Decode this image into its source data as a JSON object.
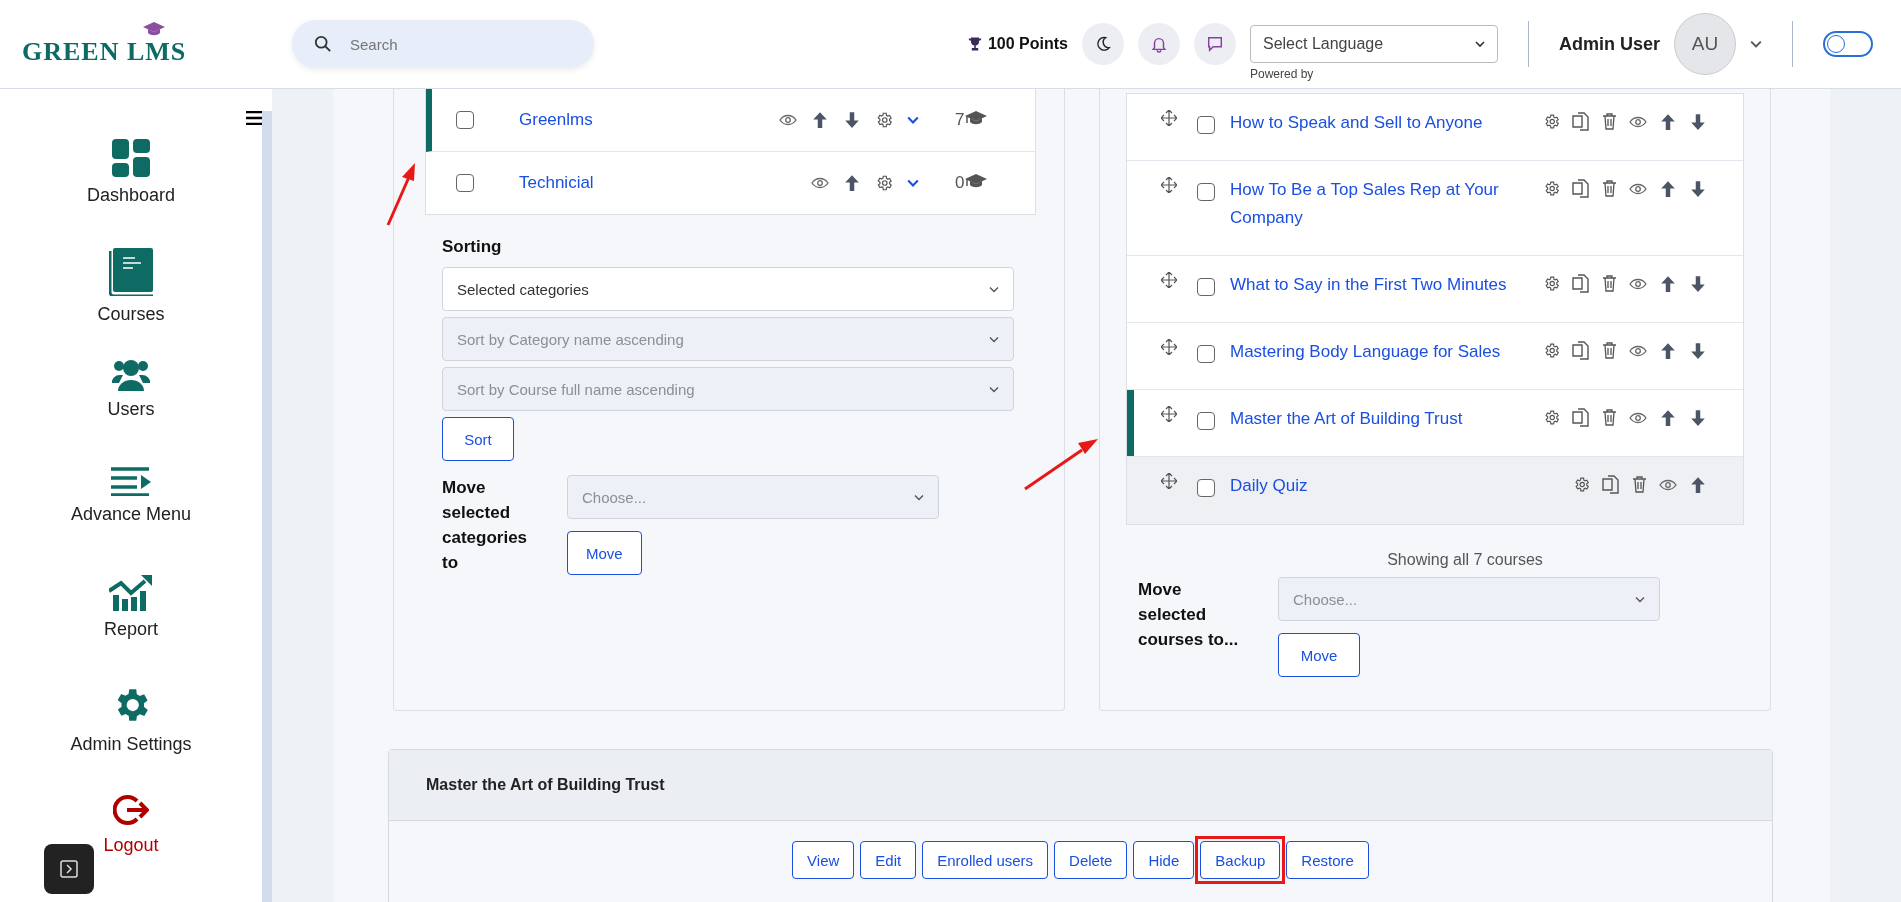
{
  "header": {
    "logo": "GREEN LMS",
    "search": {
      "placeholder": "Search"
    },
    "points": "100 Points",
    "language": {
      "value": "Select Language",
      "note": "Powered by"
    },
    "user": {
      "name": "Admin User",
      "initials": "AU"
    },
    "toggle": {
      "on": false
    }
  },
  "sidebar": {
    "items": [
      {
        "label": "Dashboard",
        "kind": "normal"
      },
      {
        "label": "Courses",
        "kind": "normal"
      },
      {
        "label": "Users",
        "kind": "normal"
      },
      {
        "label": "Advance Menu",
        "kind": "normal"
      },
      {
        "label": "Report",
        "kind": "normal"
      },
      {
        "label": "Admin Settings",
        "kind": "normal"
      },
      {
        "label": "Logout",
        "kind": "danger"
      }
    ]
  },
  "categories": {
    "rows": [
      {
        "name": "Greenlms",
        "count": "7",
        "checked": false,
        "highlighted": true,
        "can_move_down": true
      },
      {
        "name": "Technicial",
        "count": "0",
        "checked": false,
        "highlighted": false,
        "can_move_down": false
      }
    ],
    "sorting": {
      "label": "Sorting",
      "selects": [
        {
          "value": "Selected categories",
          "disabled": false
        },
        {
          "value": "Sort by Category name ascending",
          "disabled": true
        },
        {
          "value": "Sort by Course full name ascending",
          "disabled": true
        }
      ],
      "button": "Sort"
    },
    "move": {
      "label": "Move selected categories to",
      "placeholder": "Choose...",
      "disabled": true,
      "button": "Move"
    }
  },
  "courses": {
    "rows": [
      {
        "name": "How to Speak and Sell to Anyone",
        "checked": false,
        "highlighted": false,
        "hovered": false,
        "can_move_down": true
      },
      {
        "name": "How To Be a Top Sales Rep at Your Company",
        "checked": false,
        "highlighted": false,
        "hovered": false,
        "can_move_down": true
      },
      {
        "name": "What to Say in the First Two Minutes",
        "checked": false,
        "highlighted": false,
        "hovered": false,
        "can_move_down": true
      },
      {
        "name": "Mastering Body Language for Sales",
        "checked": false,
        "highlighted": false,
        "hovered": false,
        "can_move_down": true
      },
      {
        "name": "Master the Art of Building Trust",
        "checked": false,
        "highlighted": true,
        "hovered": false,
        "can_move_down": true
      },
      {
        "name": "Daily Quiz",
        "checked": false,
        "highlighted": false,
        "hovered": true,
        "can_move_down": false
      }
    ],
    "summary": "Showing all 7 courses",
    "move": {
      "label": "Move selected courses to...",
      "placeholder": "Choose...",
      "disabled": true,
      "button": "Move"
    }
  },
  "detail": {
    "title": "Master the Art of Building Trust",
    "buttons": [
      {
        "label": "View",
        "highlighted": false
      },
      {
        "label": "Edit",
        "highlighted": false
      },
      {
        "label": "Enrolled users",
        "highlighted": false
      },
      {
        "label": "Delete",
        "highlighted": false
      },
      {
        "label": "Hide",
        "highlighted": false
      },
      {
        "label": "Backup",
        "highlighted": true
      },
      {
        "label": "Restore",
        "highlighted": false
      }
    ]
  }
}
